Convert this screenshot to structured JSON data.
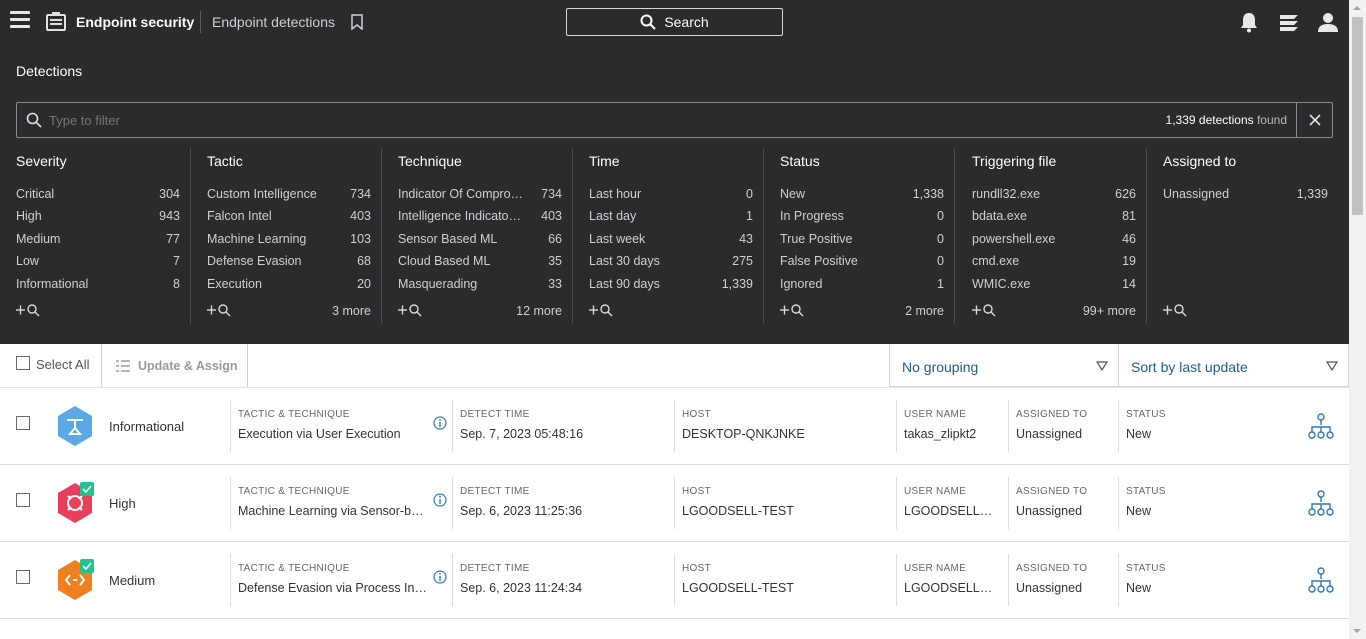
{
  "topbar": {
    "app_title": "Endpoint security",
    "page_title": "Endpoint detections",
    "search_label": "Search"
  },
  "panel": {
    "heading": "Detections",
    "filter_placeholder": "Type to filter",
    "count_number": "1,339 detections",
    "count_suffix": "found"
  },
  "facets": [
    {
      "title": "Severity",
      "rows": [
        {
          "label": "Critical",
          "count": "304"
        },
        {
          "label": "High",
          "count": "943"
        },
        {
          "label": "Medium",
          "count": "77"
        },
        {
          "label": "Low",
          "count": "7"
        },
        {
          "label": "Informational",
          "count": "8"
        }
      ],
      "more": ""
    },
    {
      "title": "Tactic",
      "rows": [
        {
          "label": "Custom Intelligence",
          "count": "734"
        },
        {
          "label": "Falcon Intel",
          "count": "403"
        },
        {
          "label": "Machine Learning",
          "count": "103"
        },
        {
          "label": "Defense Evasion",
          "count": "68"
        },
        {
          "label": "Execution",
          "count": "20"
        }
      ],
      "more": "3 more"
    },
    {
      "title": "Technique",
      "rows": [
        {
          "label": "Indicator Of Compro…",
          "count": "734"
        },
        {
          "label": "Intelligence Indicato…",
          "count": "403"
        },
        {
          "label": "Sensor Based ML",
          "count": "66"
        },
        {
          "label": "Cloud Based ML",
          "count": "35"
        },
        {
          "label": "Masquerading",
          "count": "33"
        }
      ],
      "more": "12 more"
    },
    {
      "title": "Time",
      "rows": [
        {
          "label": "Last hour",
          "count": "0"
        },
        {
          "label": "Last day",
          "count": "1"
        },
        {
          "label": "Last week",
          "count": "43"
        },
        {
          "label": "Last 30 days",
          "count": "275"
        },
        {
          "label": "Last 90 days",
          "count": "1,339"
        }
      ],
      "more": ""
    },
    {
      "title": "Status",
      "rows": [
        {
          "label": "New",
          "count": "1,338"
        },
        {
          "label": "In Progress",
          "count": "0"
        },
        {
          "label": "True Positive",
          "count": "0"
        },
        {
          "label": "False Positive",
          "count": "0"
        },
        {
          "label": "Ignored",
          "count": "1"
        }
      ],
      "more": "2 more"
    },
    {
      "title": "Triggering file",
      "rows": [
        {
          "label": "rundll32.exe",
          "count": "626"
        },
        {
          "label": "bdata.exe",
          "count": "81"
        },
        {
          "label": "powershell.exe",
          "count": "46"
        },
        {
          "label": "cmd.exe",
          "count": "19"
        },
        {
          "label": "WMIC.exe",
          "count": "14"
        }
      ],
      "more": "99+ more"
    },
    {
      "title": "Assigned to",
      "rows": [
        {
          "label": "Unassigned",
          "count": "1,339"
        }
      ],
      "more": ""
    }
  ],
  "toolbar": {
    "select_all": "Select All",
    "update_assign": "Update & Assign",
    "grouping": "No grouping",
    "sort": "Sort by last update"
  },
  "columns": {
    "tactic": "TACTIC & TECHNIQUE",
    "detect_time": "DETECT TIME",
    "host": "HOST",
    "user": "USER NAME",
    "assigned": "ASSIGNED TO",
    "status": "STATUS"
  },
  "rows": [
    {
      "severity": "Informational",
      "color": "#5aa9e6",
      "checked_badge": false,
      "tactic": "Execution via User Execution",
      "detect_time": "Sep. 7, 2023 05:48:16",
      "host": "DESKTOP-QNKJNKE",
      "user": "takas_zlipkt2",
      "assigned": "Unassigned",
      "status": "New"
    },
    {
      "severity": "High",
      "color": "#e8405a",
      "checked_badge": true,
      "tactic": "Machine Learning via Sensor-b…",
      "detect_time": "Sep. 6, 2023 11:25:36",
      "host": "LGOODSELL-TEST",
      "user": "LGOODSELL…",
      "assigned": "Unassigned",
      "status": "New"
    },
    {
      "severity": "Medium",
      "color": "#f07f1d",
      "checked_badge": true,
      "tactic": "Defense Evasion via Process Inj…",
      "detect_time": "Sep. 6, 2023 11:24:34",
      "host": "LGOODSELL-TEST",
      "user": "LGOODSELL…",
      "assigned": "Unassigned",
      "status": "New"
    }
  ],
  "colors": {
    "topbar_bg": "#2b2b2e",
    "accent_blue": "#1d5f8a",
    "badge_green": "#22c38e"
  }
}
